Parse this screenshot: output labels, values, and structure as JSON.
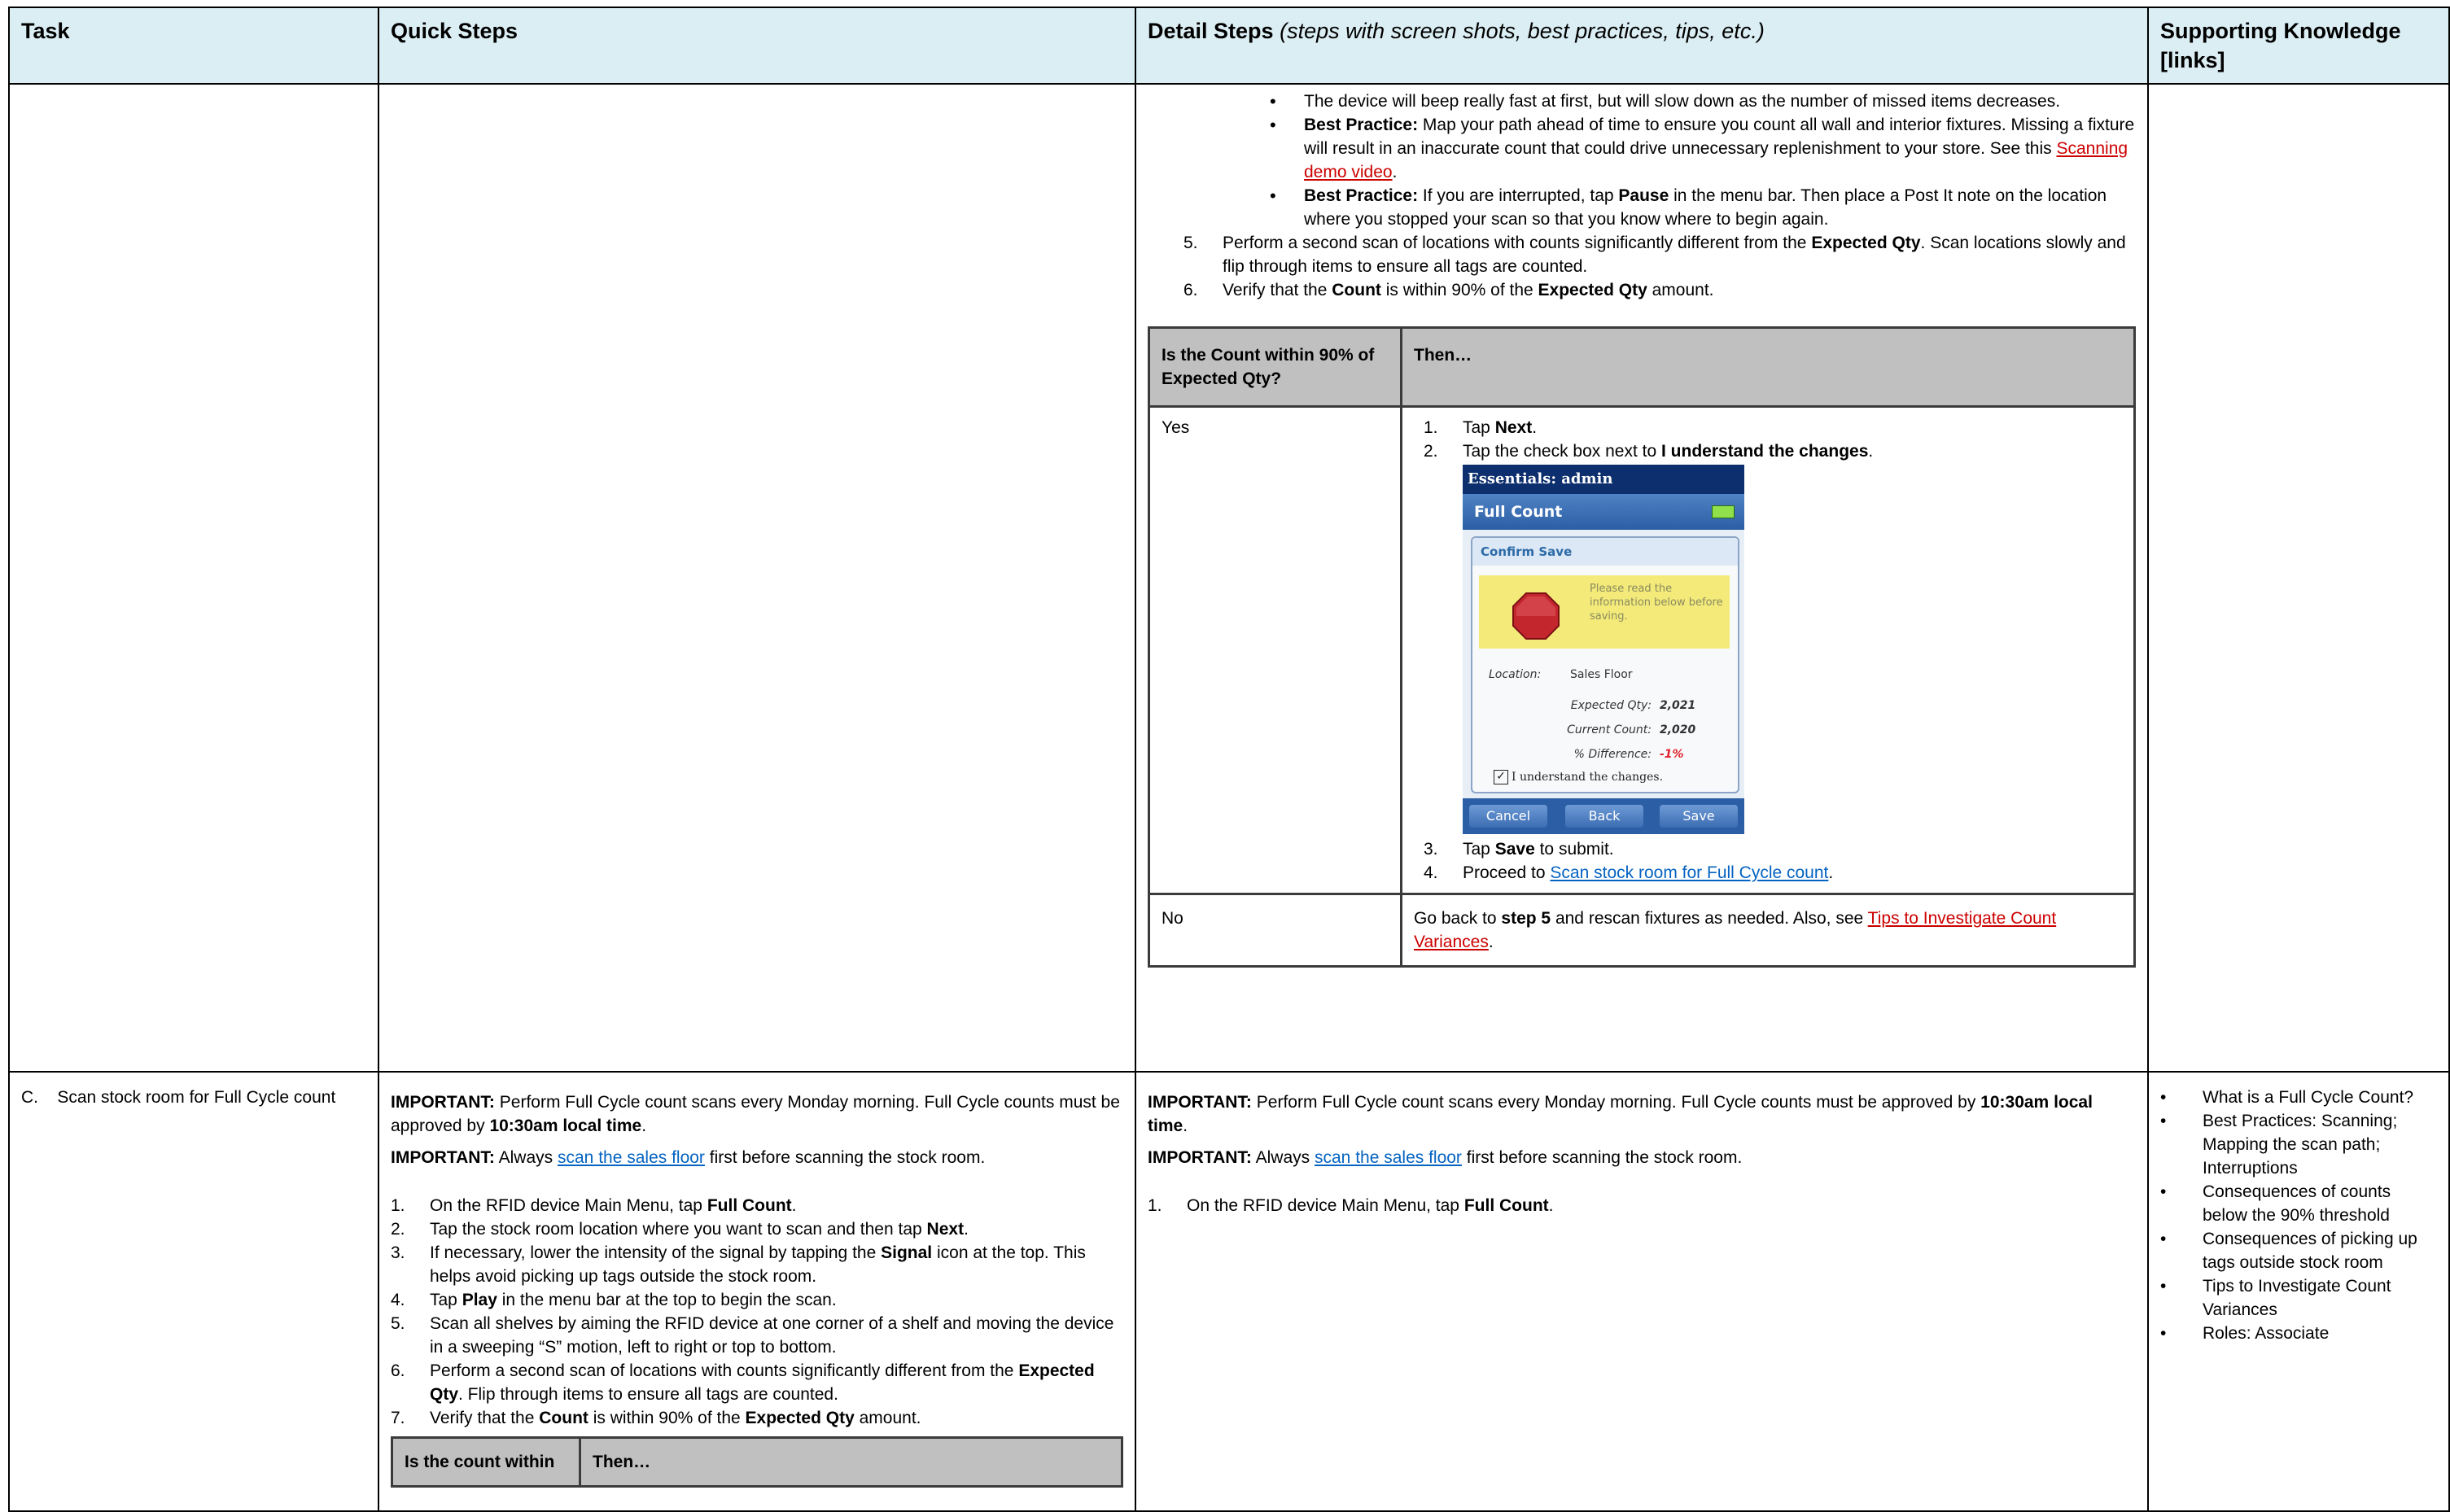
{
  "header": {
    "task": "Task",
    "quick_steps": "Quick Steps",
    "detail_steps": "Detail Steps",
    "detail_steps_note": "(steps with screen shots, best practices, tips, etc.)",
    "supporting": "Supporting Knowledge [links]"
  },
  "row1": {
    "bullets": {
      "b1": "The device will beep really fast at first, but will slow down as the number of missed items decreases.",
      "b2_label": "Best Practice:",
      "b2_text": "Map your path ahead of time to ensure you count all wall and interior fixtures. Missing a fixture will result in an inaccurate count that could drive unnecessary replenishment to your store. See this",
      "b2_link": "Scanning demo video",
      "b3_label": "Best Practice:",
      "b3_pre": "If you are interrupted, tap",
      "b3_bold": "Pause",
      "b3_post": "in the menu bar. Then place a Post It note on the location where you stopped your scan so that you know where to begin again."
    },
    "steps": {
      "s5_num": "5.",
      "s5_pre": "Perform a second scan of locations with counts significantly different from the",
      "s5_bold": "Expected Qty",
      "s5_post": ". Scan locations slowly and flip through items to ensure all tags are counted.",
      "s6_num": "6.",
      "s6_pre": "Verify that the",
      "s6_bold1": "Count",
      "s6_mid": "is within 90% of the",
      "s6_bold2": "Expected Qty",
      "s6_post": "amount."
    },
    "decision": {
      "col1": "Is the Count within 90% of Expected Qty?",
      "col2": "Then…",
      "yes": "Yes",
      "yes_1_pre": "Tap",
      "yes_1_bold": "Next",
      "yes_2_pre": "Tap the check box next to",
      "yes_2_bold": "I understand the changes",
      "yes_3_pre": "Tap",
      "yes_3_bold": "Save",
      "yes_3_post": "to submit.",
      "yes_4_pre": "Proceed to",
      "yes_4_link": "Scan stock room for Full Cycle count",
      "no": "No",
      "no_pre": "Go back to",
      "no_bold": "step 5",
      "no_mid": "and rescan fixtures as needed. Also, see",
      "no_link": "Tips to Investigate Count Variances"
    },
    "device": {
      "top": "Essentials: admin",
      "title": "Full Count",
      "dialog_title": "Confirm Save",
      "warning": "Please read the information below before saving.",
      "location_label": "Location:",
      "location_value": "Sales Floor",
      "expected_label": "Expected Qty:",
      "expected_value": "2,021",
      "current_label": "Current Count:",
      "current_value": "2,020",
      "diff_label": "% Difference:",
      "diff_value": "-1%",
      "check_label": "I understand the changes.",
      "btn_cancel": "Cancel",
      "btn_back": "Back",
      "btn_save": "Save"
    }
  },
  "row2": {
    "task": "C.    Scan stock room for Full Cycle count",
    "important_label": "IMPORTANT:",
    "imp1_text": "Perform Full Cycle count scans every Monday morning. Full Cycle counts must be approved by",
    "imp1_bold": "10:30am local time",
    "imp2_pre": "Always",
    "imp2_link": "scan the sales floor",
    "imp2_post": "first before scanning the stock room.",
    "qs": {
      "s1_pre": "On the RFID device Main Menu, tap",
      "s1_bold": "Full Count",
      "s2_pre": "Tap the stock room location where you want to scan and then tap",
      "s2_bold": "Next",
      "s3_pre": "If necessary, lower the intensity of the signal by tapping the",
      "s3_bold": "Signal",
      "s3_post": "icon at the top. This helps avoid picking up tags outside the stock room.",
      "s4_pre": "Tap",
      "s4_bold": "Play",
      "s4_post": "in the menu bar at the top to begin the scan.",
      "s5": "Scan all shelves by aiming the RFID device at one corner of a shelf and moving the device in a sweeping “S” motion, left to right or top to bottom.",
      "s6_pre": "Perform a second scan of locations with counts significantly different from the",
      "s6_bold": "Expected Qty",
      "s6_post": ". Flip through items to ensure all tags are counted.",
      "s7_pre": "Verify that the",
      "s7_bold1": "Count",
      "s7_mid": "is within 90% of the",
      "s7_bold2": "Expected Qty",
      "s7_post": "amount.",
      "mini_col1": "Is the count within",
      "mini_col2": "Then…"
    },
    "ds": {
      "s1_pre": "On the RFID device Main Menu, tap",
      "s1_bold": "Full Count"
    },
    "supporting": [
      "What is a Full Cycle Count?",
      "Best Practices: Scanning; Mapping the scan path; Interruptions",
      "Consequences of counts below the 90% threshold",
      "Consequences of picking up tags outside stock room",
      "Tips to Investigate Count Variances",
      "Roles: Associate"
    ]
  }
}
